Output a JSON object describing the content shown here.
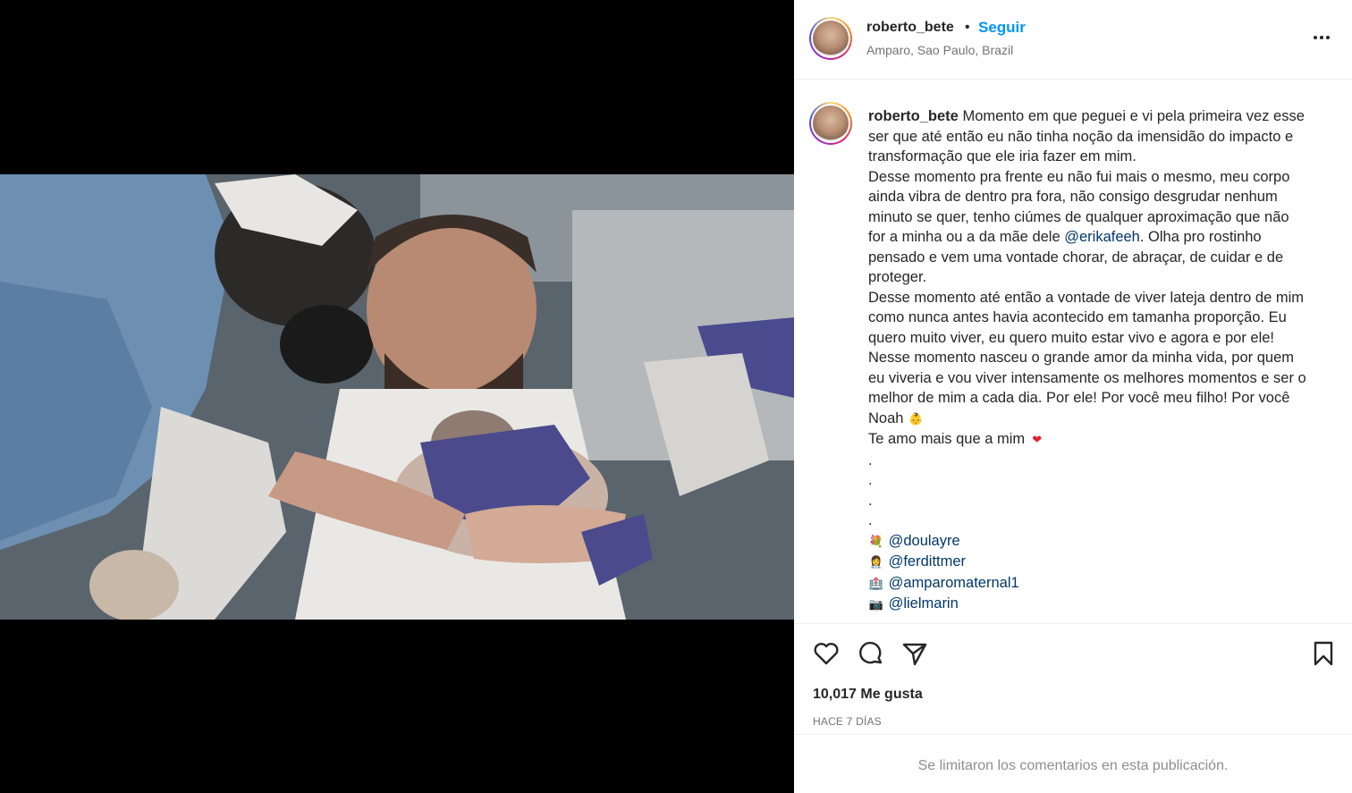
{
  "header": {
    "username": "roberto_bete",
    "separator": "•",
    "follow_label": "Seguir",
    "location": "Amparo, Sao Paulo, Brazil"
  },
  "caption": {
    "username": "roberto_bete",
    "lines": [
      "Momento em que peguei e vi pela primeira vez esse",
      "ser que até então eu não tinha noção da imensidão do impacto e",
      "transformação que ele iria fazer em mim.",
      "Desse momento pra frente eu não fui mais o mesmo, meu corpo",
      "ainda vibra de dentro pra fora, não consigo desgrudar nenhum",
      "minuto se quer, tenho ciúmes de qualquer aproximação que não",
      "for a minha ou a da mãe dele",
      "@erikafeeh",
      ". Olha pro rostinho",
      "pensado e vem uma vontade chorar, de abraçar, de cuidar e de",
      "proteger.",
      "Desse momento até então a vontade de viver lateja dentro de mim",
      "como nunca antes havia acontecido em tamanha proporção. Eu",
      "quero muito viver, eu quero muito estar vivo e agora e por ele!",
      "Nesse momento nasceu o grande amor da minha vida, por quem",
      "eu viveria e vou viver intensamente os melhores momentos e ser o",
      "melhor de mim a cada dia. Por ele! Por você meu filho! Por você",
      "Noah",
      "Te amo mais que a mim",
      ".",
      ".",
      ".",
      "."
    ],
    "emojis": {
      "baby": "👶",
      "heart": "❤",
      "doula": "💐",
      "doctor": "👩‍⚕️",
      "hospital": "🏥",
      "camera": "📷"
    },
    "mentions": [
      "@doulayre",
      "@ferdittmer",
      "@amparomaternal1",
      "@lielmarin"
    ]
  },
  "actions": {
    "likes": "10,017 Me gusta",
    "time": "HACE 7 DÍAS",
    "comments_limited": "Se limitaron los comentarios en esta publicación."
  },
  "colors": {
    "accent": "#0095f6",
    "mention": "#00376b",
    "secondary_text": "#737373"
  }
}
